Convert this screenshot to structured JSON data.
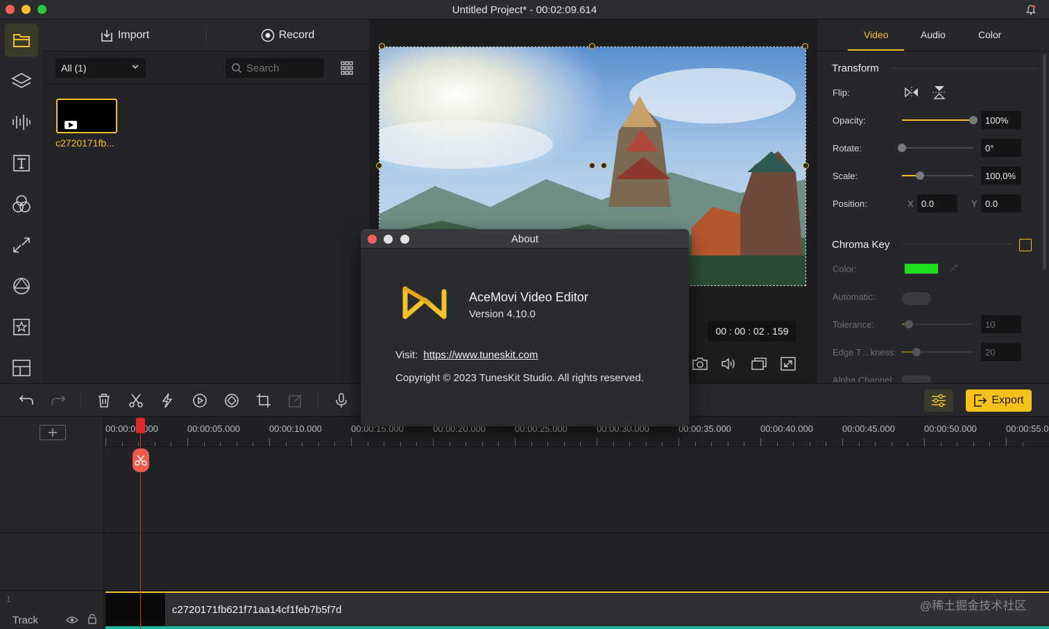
{
  "window": {
    "title": "Untitled Project* - 00:02:09.614"
  },
  "sidebar": {
    "items": [
      {
        "name": "media-library",
        "icon": "folder-icon",
        "active": true
      },
      {
        "name": "layers",
        "icon": "layers-icon"
      },
      {
        "name": "audio",
        "icon": "audio-waveform-icon"
      },
      {
        "name": "text",
        "icon": "text-icon"
      },
      {
        "name": "filters",
        "icon": "filters-icon"
      },
      {
        "name": "transitions",
        "icon": "transition-arrows-icon"
      },
      {
        "name": "elements",
        "icon": "elements-icon"
      },
      {
        "name": "stickers",
        "icon": "star-icon"
      },
      {
        "name": "split-screen",
        "icon": "layout-icon"
      }
    ]
  },
  "media": {
    "import_label": "Import",
    "record_label": "Record",
    "filter_selected": "All (1)",
    "search_placeholder": "Search",
    "clip_label": "c2720171fb..."
  },
  "preview": {
    "timecode": "00 : 00 : 02 . 159"
  },
  "props": {
    "tabs": [
      "Video",
      "Audio",
      "Color"
    ],
    "active_tab": "Video",
    "transform_title": "Transform",
    "flip_label": "Flip:",
    "opacity_label": "Opacity:",
    "opacity_value": "100%",
    "opacity_level": 1.0,
    "rotate_label": "Rotate:",
    "rotate_value": "0°",
    "rotate_level": 0.0,
    "scale_label": "Scale:",
    "scale_value": "100.0%",
    "scale_level": 0.25,
    "position_label": "Position:",
    "pos_x_label": "X",
    "pos_x_value": "0.0",
    "pos_y_label": "Y",
    "pos_y_value": "0.0",
    "chroma_title": "Chroma Key",
    "chroma_enabled": false,
    "color_label": "Color:",
    "chroma_color": "#1fe01f",
    "automatic_label": "Automatic:",
    "tolerance_label": "Tolerance:",
    "tolerance_value": "10",
    "tolerance_level": 0.1,
    "edge_label": "Edge T…kness:",
    "edge_value": "20",
    "edge_level": 0.2,
    "alpha_label": "Alpha Channel:"
  },
  "toolbar": {
    "export_label": "Export",
    "accent": "#f7c11c"
  },
  "timeline": {
    "ruler": [
      "00:00:00.000",
      "00:00:05.000",
      "00:00:10.000",
      "00:00:15.000",
      "00:00:20.000",
      "00:00:25.000",
      "00:00:30.000",
      "00:00:35.000",
      "00:00:40.000",
      "00:00:45.000",
      "00:00:50.000",
      "00:00:55.0"
    ],
    "track_number": "1",
    "track_label": "Track",
    "clip_name": "c2720171fb621f71aa14cf1feb7b5f7d",
    "watermark": "@稀土掘金技术社区"
  },
  "about": {
    "title": "About",
    "app_name": "AceMovi Video Editor",
    "version": "Version 4.10.0",
    "visit_label": "Visit:",
    "url": "https://www.tuneskit.com",
    "copyright": "Copyright © 2023 TunesKit Studio. All rights reserved."
  }
}
